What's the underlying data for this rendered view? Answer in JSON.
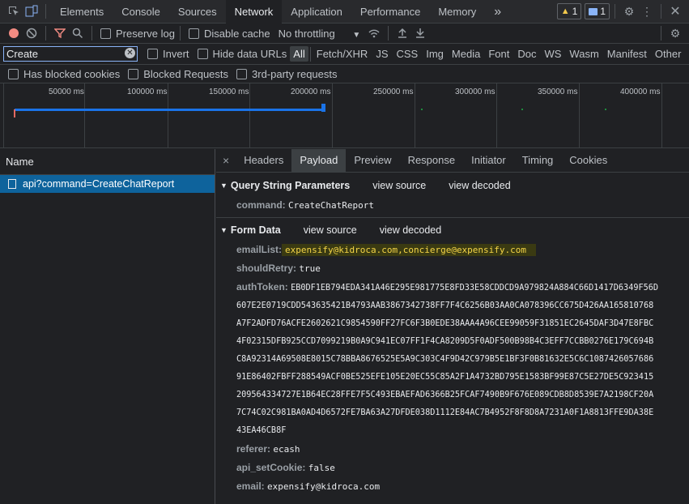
{
  "topbar": {
    "tabs": [
      "Elements",
      "Console",
      "Sources",
      "Network",
      "Application",
      "Performance",
      "Memory"
    ],
    "more": "»",
    "warnings": "1",
    "messages": "1"
  },
  "toolbar": {
    "preserve_log": "Preserve log",
    "disable_cache": "Disable cache",
    "throttling": "No throttling"
  },
  "filter": {
    "value": "Create",
    "invert": "Invert",
    "hide_data_urls": "Hide data URLs",
    "types": [
      "All",
      "Fetch/XHR",
      "JS",
      "CSS",
      "Img",
      "Media",
      "Font",
      "Doc",
      "WS",
      "Wasm",
      "Manifest",
      "Other"
    ],
    "selected_type": "All"
  },
  "blocked": {
    "blocked_cookies": "Has blocked cookies",
    "blocked_requests": "Blocked Requests",
    "third_party": "3rd-party requests"
  },
  "overview": {
    "ticks": [
      "50000 ms",
      "100000 ms",
      "150000 ms",
      "200000 ms",
      "250000 ms",
      "300000 ms",
      "350000 ms",
      "400000 ms"
    ]
  },
  "requests": {
    "header": "Name",
    "items": [
      {
        "name": "api?command=CreateChatReport"
      }
    ]
  },
  "details": {
    "close": "×",
    "tabs": [
      "Headers",
      "Payload",
      "Preview",
      "Response",
      "Initiator",
      "Timing",
      "Cookies"
    ],
    "active_tab": "Payload",
    "query": {
      "title": "Query String Parameters",
      "view_source": "view source",
      "view_decoded": "view decoded",
      "params": [
        {
          "key": "command:",
          "value": "CreateChatReport"
        }
      ]
    },
    "form": {
      "title": "Form Data",
      "view_source": "view source",
      "view_decoded": "view decoded",
      "emailList_key": "emailList:",
      "emailList_value": "expensify@kidroca.com,concierge@expensify.com",
      "shouldRetry_key": "shouldRetry:",
      "shouldRetry_value": "true",
      "authToken_key": "authToken:",
      "authToken_lines": [
        "EB0DF1EB794EDA341A46E295E981775E8FD33E58CDDCD9A979824A884C66D1417D6349F56D",
        "607E2E0719CDD543635421B4793AAB3867342738FF7F4C6256B03AA0CA078396CC675D426AA165810768",
        "A7F2ADFD76ACFE2602621C9854590FF27FC6F3B0EDE38AAA4A96CEE99059F31851EC2645DAF3D47E8FBC",
        "4F02315DFB925CCD7099219B0A9C941EC07FF1F4CA8209D5F0ADF500B98B4C3EFF7CCBB0276E179C694B",
        "C8A92314A69508E8015C78BBA8676525E5A9C303C4F9D42C979B5E1BF3F0B81632E5C6C1087426057686",
        "91E86402FBFF288549ACF0BE525EFE105E20EC55C85A2F1A4732BD795E1583BF99E87C5E27DE5C923415",
        "209564334727E1B64EC28FFE7F5C493EBAEFAD6366B25FCAF7490B9F676E089CDB8D8539E7A2198CF20A",
        "7C74C02C981BA0AD4D6572FE7BA63A27DFDE038D1112E84AC7B4952F8F8D8A7231A0F1A8813FFE9DA38E",
        "43EA46CB8F"
      ],
      "referer_key": "referer:",
      "referer_value": "ecash",
      "api_setCookie_key": "api_setCookie:",
      "api_setCookie_value": "false",
      "email_key": "email:",
      "email_value": "expensify@kidroca.com"
    }
  }
}
